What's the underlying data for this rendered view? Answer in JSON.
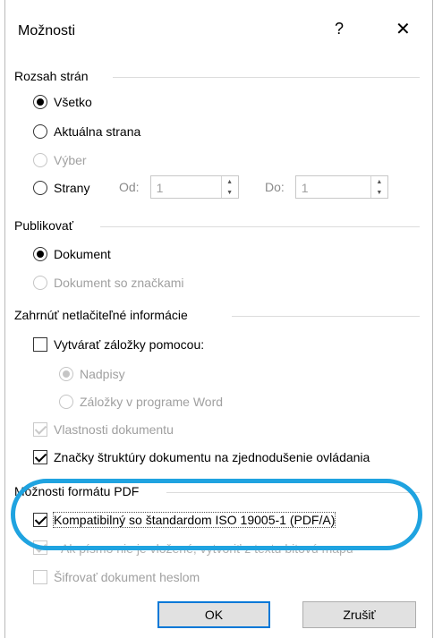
{
  "dialog": {
    "title": "Možnosti",
    "help_label": "?",
    "close_label": "✕"
  },
  "page_range": {
    "label": "Rozsah strán",
    "all": "Všetko",
    "current": "Aktuálna strana",
    "selection": "Výber",
    "pages": "Strany",
    "from_label": "Od:",
    "from_value": "1",
    "to_label": "Do:",
    "to_value": "1"
  },
  "publish": {
    "label": "Publikovať",
    "document": "Dokument",
    "document_markup": "Dokument so značkami"
  },
  "nonprint": {
    "label": "Zahrnúť netlačiteľné informácie",
    "create_bookmarks": "Vytvárať záložky pomocou:",
    "headings": "Nadpisy",
    "word_bookmarks": "Záložky v programe Word",
    "doc_properties": "Vlastnosti dokumentu",
    "structure_tags": "Značky štruktúry dokumentu na zjednodušenie ovládania"
  },
  "pdf": {
    "label": "Možnosti formátu PDF",
    "iso": "Kompatibilný so štandardom ISO 19005-1 (PDF/A)",
    "bitmap_text": "Ak písmo nie je vložené, vytvoriť z textu bitovú mapu",
    "encrypt": "Šifrovať dokument heslom"
  },
  "buttons": {
    "ok": "OK",
    "cancel": "Zrušiť"
  },
  "colors": {
    "annotation": "#1fa3e0",
    "default_button_border": "#0078d7"
  }
}
